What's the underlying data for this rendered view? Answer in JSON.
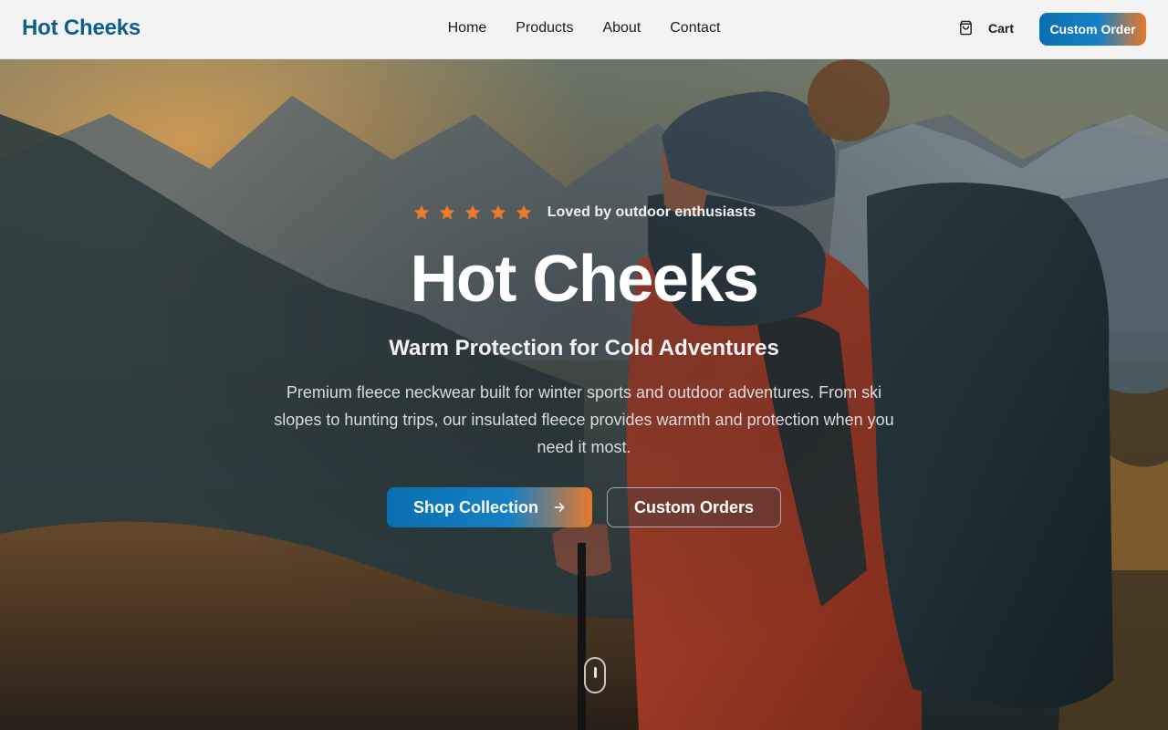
{
  "brand": {
    "name": "Hot Cheeks"
  },
  "nav": {
    "links": [
      "Home",
      "Products",
      "About",
      "Contact"
    ],
    "cart_label": "Cart",
    "cta_label": "Custom Order"
  },
  "hero": {
    "rating": {
      "stars": 5,
      "text": "Loved by outdoor enthusiasts"
    },
    "title": "Hot Cheeks",
    "subtitle": "Warm Protection for Cold Adventures",
    "description": "Premium fleece neckwear built for winter sports and outdoor adventures. From ski slopes to hunting trips, our insulated fleece provides warmth and protection when you need it most.",
    "primary_button": "Shop Collection",
    "secondary_button": "Custom Orders"
  },
  "icons": {
    "cart": "shopping-bag-icon",
    "star": "star-icon",
    "arrow": "arrow-right-icon",
    "scroll": "mouse-scroll-icon"
  },
  "colors": {
    "brand": "#0b5f8a",
    "accent_blue": "#0a6fb0",
    "accent_orange": "#e8782a",
    "star": "#f07a2a"
  }
}
